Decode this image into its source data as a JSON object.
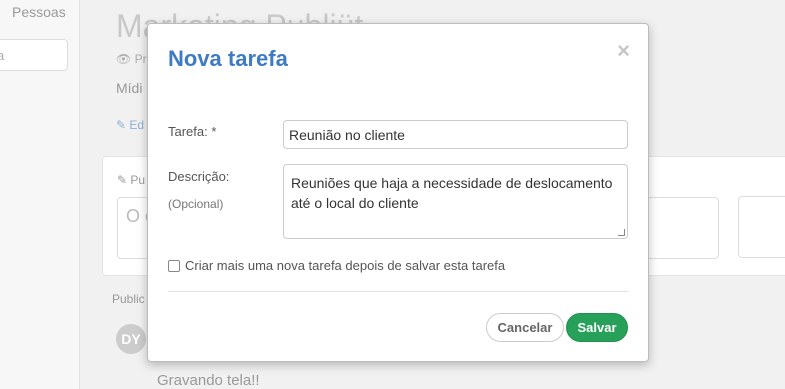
{
  "background": {
    "left_tab": "Pessoas",
    "left_input_text": "a",
    "title": "Marketing Publiüt",
    "meta": "Pro",
    "midia": "Mídi",
    "edit": "Ed",
    "card_head": "Pu",
    "card_placeholder": "O c",
    "publicacoes": "Public",
    "avatar_initials": "DY",
    "post_text": "Gravando tela!!"
  },
  "modal": {
    "title": "Nova tarefa",
    "close_symbol": "×",
    "task_label": "Tarefa: *",
    "task_value": "Reunião no cliente",
    "description_label": "Descrição:",
    "optional_label": "(Opcional)",
    "description_value": "Reuniões que haja a necessidade de deslocamento até o local do cliente",
    "checkbox_label": "Criar mais uma nova tarefa depois de salvar esta tarefa",
    "checkbox_checked": false,
    "cancel_label": "Cancelar",
    "save_label": "Salvar"
  },
  "colors": {
    "title": "#3e7bc4",
    "save": "#27a15a"
  }
}
